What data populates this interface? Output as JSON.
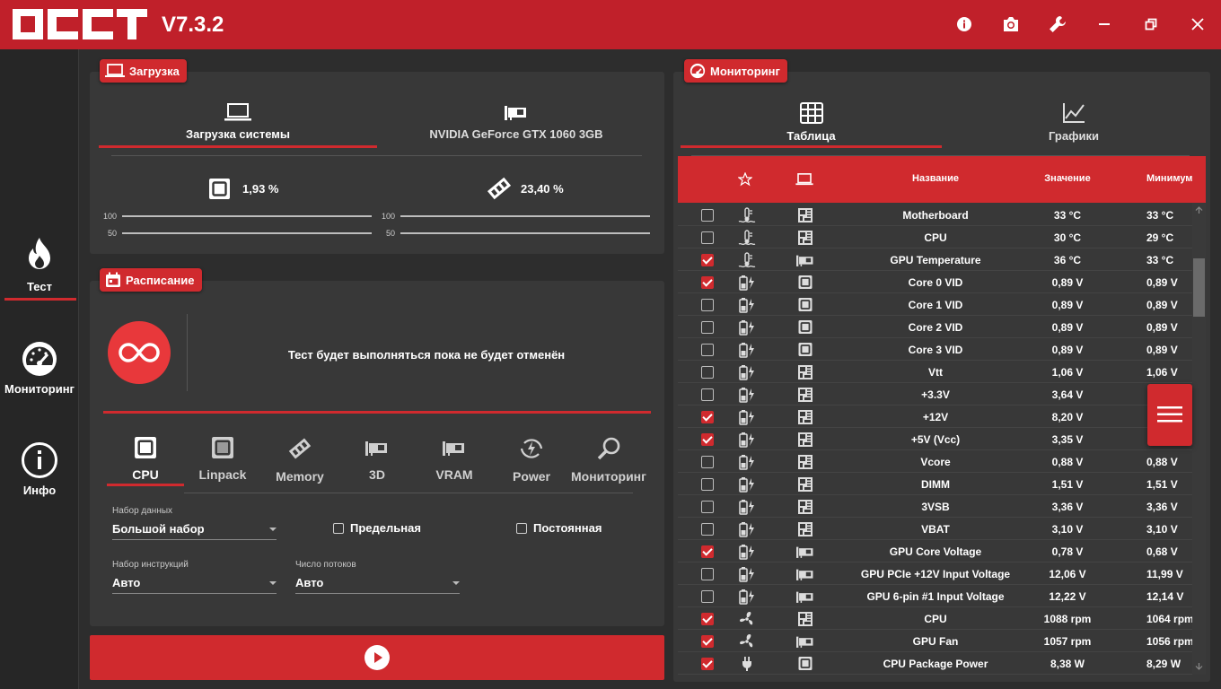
{
  "app": {
    "version": "V7.3.2"
  },
  "sidebar": {
    "items": [
      {
        "label": "Тест"
      },
      {
        "label": "Мониторинг"
      },
      {
        "label": "Инфо"
      }
    ]
  },
  "load": {
    "title": "Загрузка",
    "tabs": [
      {
        "label": "Загрузка системы"
      },
      {
        "label": "NVIDIA GeForce GTX 1060 3GB"
      }
    ],
    "cpu_value": "1,93 %",
    "ram_value": "23,40 %",
    "scale": {
      "hi": "100",
      "lo": "50"
    }
  },
  "schedule": {
    "title": "Расписание",
    "message": "Тест будет выполняться пока не будет отменён"
  },
  "tests": {
    "tabs": [
      {
        "label": "CPU"
      },
      {
        "label": "Linpack"
      },
      {
        "label": "Memory"
      },
      {
        "label": "3D"
      },
      {
        "label": "VRAM"
      },
      {
        "label": "Power"
      },
      {
        "label": "Мониторинг"
      }
    ]
  },
  "options": {
    "dataset": {
      "label": "Набор данных",
      "value": "Большой набор"
    },
    "extreme": {
      "label": "Предельная"
    },
    "constant": {
      "label": "Постоянная"
    },
    "instructions": {
      "label": "Набор инструкций",
      "value": "Авто"
    },
    "threads": {
      "label": "Число потоков",
      "value": "Авто"
    }
  },
  "monitoring": {
    "title": "Мониторинг",
    "tabs": [
      {
        "label": "Таблица"
      },
      {
        "label": "Графики"
      }
    ],
    "headers": {
      "name": "Название",
      "value": "Значение",
      "min": "Минимум"
    },
    "rows": [
      {
        "checked": false,
        "type": "temp",
        "src": "board",
        "name": "Motherboard",
        "value": "33 °C",
        "min": "33 °C"
      },
      {
        "checked": false,
        "type": "temp",
        "src": "board",
        "name": "CPU",
        "value": "30 °C",
        "min": "29 °C"
      },
      {
        "checked": true,
        "type": "temp",
        "src": "gpu",
        "name": "GPU Temperature",
        "value": "36 °C",
        "min": "33 °C"
      },
      {
        "checked": true,
        "type": "volt",
        "src": "cpu",
        "name": "Core 0 VID",
        "value": "0,89 V",
        "min": "0,89 V"
      },
      {
        "checked": false,
        "type": "volt",
        "src": "cpu",
        "name": "Core 1 VID",
        "value": "0,89 V",
        "min": "0,89 V"
      },
      {
        "checked": false,
        "type": "volt",
        "src": "cpu",
        "name": "Core 2 VID",
        "value": "0,89 V",
        "min": "0,89 V"
      },
      {
        "checked": false,
        "type": "volt",
        "src": "cpu",
        "name": "Core 3 VID",
        "value": "0,89 V",
        "min": "0,89 V"
      },
      {
        "checked": false,
        "type": "volt",
        "src": "board",
        "name": "Vtt",
        "value": "1,06 V",
        "min": "1,06 V"
      },
      {
        "checked": false,
        "type": "volt",
        "src": "board",
        "name": "+3.3V",
        "value": "3,64 V",
        "min": ""
      },
      {
        "checked": true,
        "type": "volt",
        "src": "board",
        "name": "+12V",
        "value": "8,20 V",
        "min": ""
      },
      {
        "checked": true,
        "type": "volt",
        "src": "board",
        "name": "+5V (Vcc)",
        "value": "3,35 V",
        "min": ""
      },
      {
        "checked": false,
        "type": "volt",
        "src": "board",
        "name": "Vcore",
        "value": "0,88 V",
        "min": "0,88 V"
      },
      {
        "checked": false,
        "type": "volt",
        "src": "board",
        "name": "DIMM",
        "value": "1,51 V",
        "min": "1,51 V"
      },
      {
        "checked": false,
        "type": "volt",
        "src": "board",
        "name": "3VSB",
        "value": "3,36 V",
        "min": "3,36 V"
      },
      {
        "checked": false,
        "type": "volt",
        "src": "board",
        "name": "VBAT",
        "value": "3,10 V",
        "min": "3,10 V"
      },
      {
        "checked": true,
        "type": "volt",
        "src": "gpu",
        "name": "GPU Core Voltage",
        "value": "0,78 V",
        "min": "0,68 V"
      },
      {
        "checked": false,
        "type": "volt",
        "src": "gpu",
        "name": "GPU PCIe +12V Input Voltage",
        "value": "12,06 V",
        "min": "11,99 V"
      },
      {
        "checked": false,
        "type": "volt",
        "src": "gpu",
        "name": "GPU 6-pin #1 Input Voltage",
        "value": "12,22 V",
        "min": "12,14 V"
      },
      {
        "checked": true,
        "type": "fan",
        "src": "board",
        "name": "CPU",
        "value": "1088 rpm",
        "min": "1064 rpm"
      },
      {
        "checked": true,
        "type": "fan",
        "src": "gpu",
        "name": "GPU Fan",
        "value": "1057 rpm",
        "min": "1056 rpm"
      },
      {
        "checked": true,
        "type": "power",
        "src": "cpu",
        "name": "CPU Package Power",
        "value": "8,38 W",
        "min": "8,29 W"
      }
    ]
  }
}
